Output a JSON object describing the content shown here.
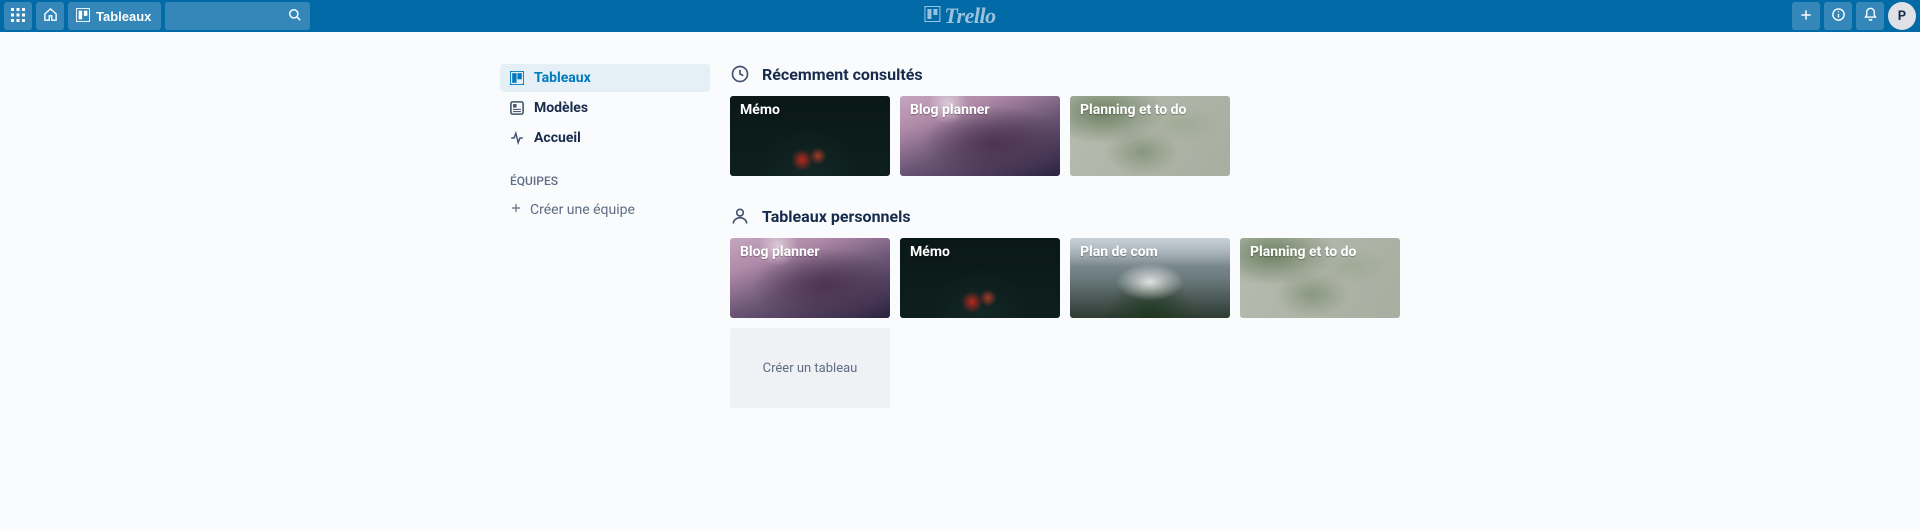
{
  "header": {
    "boards_label": "Tableaux",
    "logo_text": "Trello",
    "avatar_initial": "P"
  },
  "sidebar": {
    "items": [
      {
        "label": "Tableaux"
      },
      {
        "label": "Modèles"
      },
      {
        "label": "Accueil"
      }
    ],
    "teams_heading": "ÉQUIPES",
    "create_team_label": "Créer une équipe"
  },
  "sections": {
    "recent": {
      "title": "Récemment consultés",
      "boards": [
        {
          "title": "Mémo"
        },
        {
          "title": "Blog planner"
        },
        {
          "title": "Planning et to do"
        }
      ]
    },
    "personal": {
      "title": "Tableaux personnels",
      "boards": [
        {
          "title": "Blog planner"
        },
        {
          "title": "Mémo"
        },
        {
          "title": "Plan de com"
        },
        {
          "title": "Planning et to do"
        }
      ],
      "create_board_label": "Créer un tableau"
    }
  }
}
